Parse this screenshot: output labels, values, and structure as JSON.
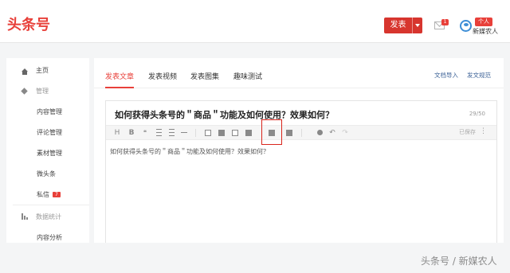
{
  "header": {
    "logo": "头条号",
    "publish_label": "发表",
    "mail_badge": "1",
    "user_tag": "个人",
    "user_name": "新媒农人"
  },
  "sidebar": {
    "items": [
      {
        "label": "主页",
        "icon": "home-icon"
      },
      {
        "label": "管理",
        "icon": "cube-icon"
      },
      {
        "label": "内容管理"
      },
      {
        "label": "评论管理"
      },
      {
        "label": "素材管理"
      },
      {
        "label": "微头条"
      },
      {
        "label": "私信",
        "badge": "7"
      },
      {
        "label": "数据统计",
        "icon": "bar-chart-icon"
      },
      {
        "label": "内容分析"
      }
    ]
  },
  "tabs": [
    {
      "label": "发表文章",
      "active": true
    },
    {
      "label": "发表视频"
    },
    {
      "label": "发表图集"
    },
    {
      "label": "趣味测试"
    }
  ],
  "tab_links": {
    "import": "文档导入",
    "rules": "发文规范"
  },
  "editor": {
    "title": "如何获得头条号的＂商品＂功能及如何使用？效果如何？",
    "char_count": "29/50",
    "saved": "已保存",
    "more": "⋮",
    "body": "如何获得头条号的＂商品＂功能及如何使用？效果如何？",
    "toolbar": {
      "heading": "H",
      "bold": "B",
      "quote": "❝",
      "undo": "↶",
      "redo": "↷"
    }
  },
  "watermark": "头条号 / 新媒农人",
  "colors": {
    "brand_red": "#e8403a",
    "link_blue": "#406599",
    "highlight_red": "#d9251c"
  }
}
